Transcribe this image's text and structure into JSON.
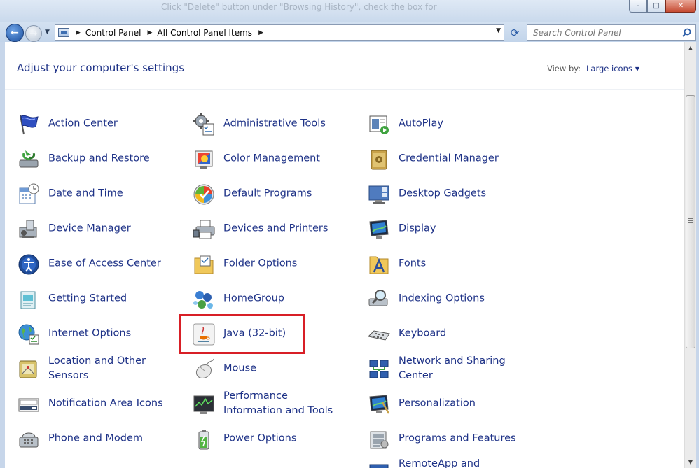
{
  "window": {
    "behind_text": "Click \"Delete\" button under \"Browsing History\", check the box for",
    "buttons": {
      "minimize": "–",
      "maximize": "□",
      "close": "✕"
    }
  },
  "nav": {
    "back_glyph": "←",
    "forward_glyph": "→",
    "breadcrumbs": [
      "Control Panel",
      "All Control Panel Items"
    ],
    "search_placeholder": "Search Control Panel"
  },
  "header": {
    "title": "Adjust your computer's settings",
    "view_by_label": "View by:",
    "view_by_value": "Large icons"
  },
  "items": {
    "col1": [
      {
        "label": "Action Center"
      },
      {
        "label": "Backup and Restore"
      },
      {
        "label": "Date and Time"
      },
      {
        "label": "Device Manager"
      },
      {
        "label": "Ease of Access Center"
      },
      {
        "label": "Getting Started"
      },
      {
        "label": "Internet Options"
      },
      {
        "label": "Location and Other Sensors"
      },
      {
        "label": "Notification Area Icons"
      },
      {
        "label": "Phone and Modem"
      }
    ],
    "col2": [
      {
        "label": "Administrative Tools"
      },
      {
        "label": "Color Management"
      },
      {
        "label": "Default Programs"
      },
      {
        "label": "Devices and Printers"
      },
      {
        "label": "Folder Options"
      },
      {
        "label": "HomeGroup"
      },
      {
        "label": "Java (32-bit)"
      },
      {
        "label": "Mouse"
      },
      {
        "label": "Performance Information and Tools"
      },
      {
        "label": "Power Options"
      }
    ],
    "col3": [
      {
        "label": "AutoPlay"
      },
      {
        "label": "Credential Manager"
      },
      {
        "label": "Desktop Gadgets"
      },
      {
        "label": "Display"
      },
      {
        "label": "Fonts"
      },
      {
        "label": "Indexing Options"
      },
      {
        "label": "Keyboard"
      },
      {
        "label": "Network and Sharing Center"
      },
      {
        "label": "Personalization"
      },
      {
        "label": "Programs and Features"
      },
      {
        "label": "RemoteApp and Desktop"
      }
    ]
  },
  "colors": {
    "link": "#1e3287",
    "highlight": "#d81f26"
  }
}
